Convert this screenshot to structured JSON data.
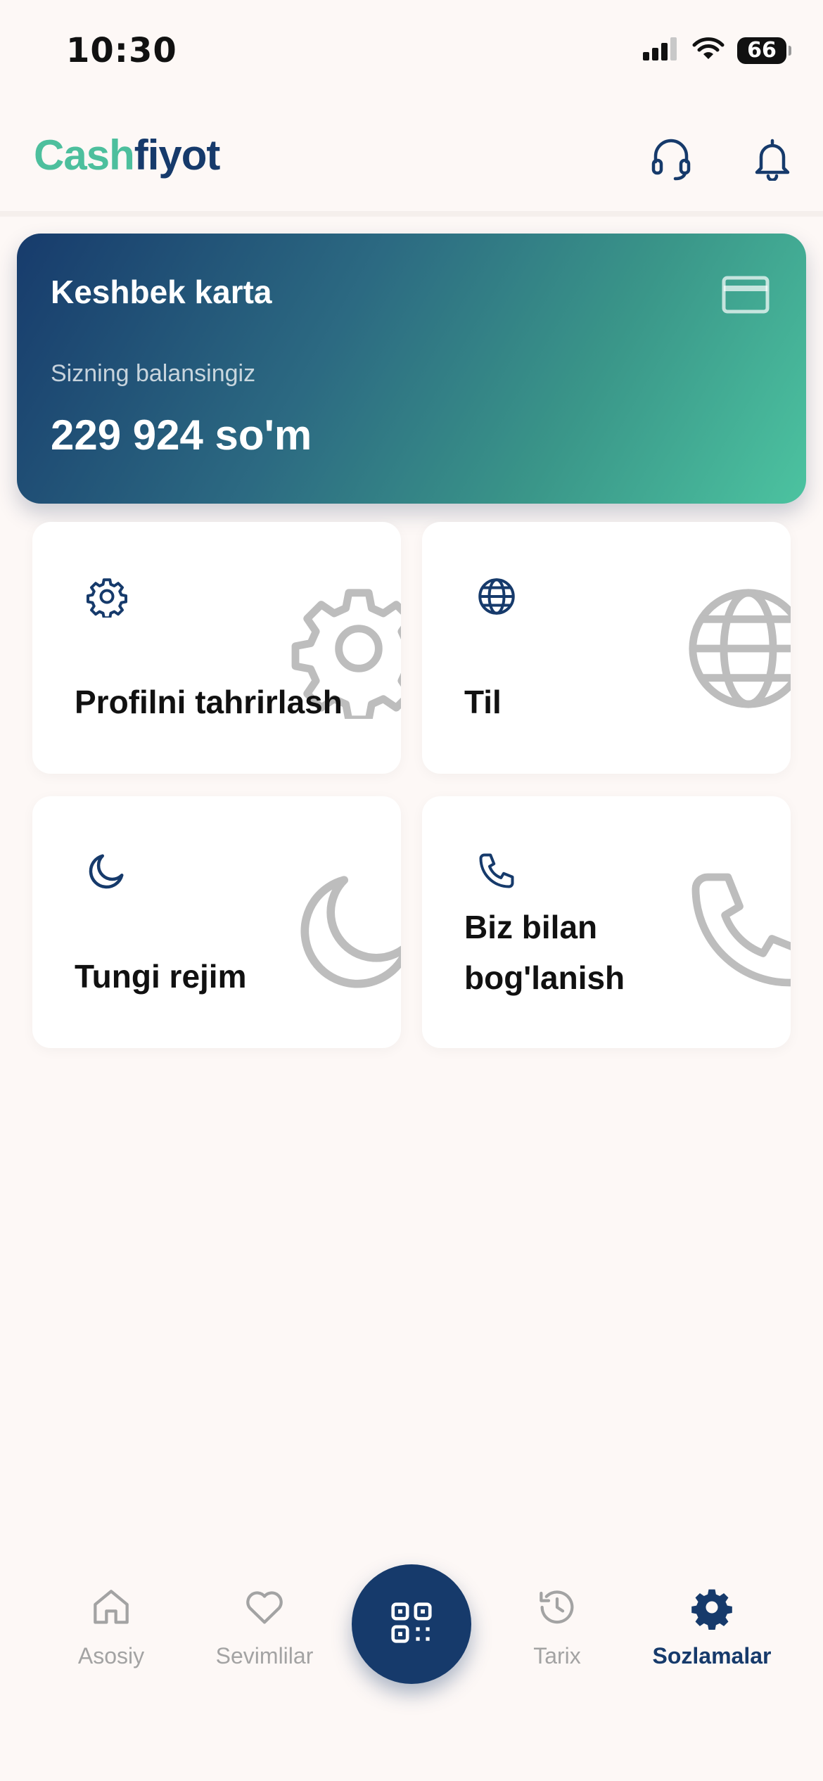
{
  "status_bar": {
    "time": "10:30",
    "battery": "66"
  },
  "header": {
    "logo_part1": "Cash",
    "logo_part2": "fiyot",
    "support_icon": "headset-icon",
    "notifications_icon": "bell-icon"
  },
  "card": {
    "title": "Keshbek karta",
    "subtitle": "Sizning balansingiz",
    "balance": "229 924 so'm",
    "icon": "credit-card-icon"
  },
  "tiles": [
    {
      "label": "Profilni tahrirlash",
      "icon": "gear-icon"
    },
    {
      "label": "Til",
      "icon": "globe-icon"
    },
    {
      "label": "Tungi rejim",
      "icon": "moon-icon"
    },
    {
      "label_line1": "Biz bilan",
      "label_line2": "bog'lanish",
      "icon": "phone-icon"
    }
  ],
  "bottom_nav": {
    "items": [
      {
        "label": "Asosiy",
        "icon": "home-icon"
      },
      {
        "label": "Sevimlilar",
        "icon": "heart-icon"
      },
      {
        "label": "Tarix",
        "icon": "history-icon"
      },
      {
        "label": "Sozlamalar",
        "icon": "gear-icon",
        "active": true
      }
    ],
    "center_icon": "qr-code-icon"
  },
  "colors": {
    "brand_navy": "#163a6b",
    "brand_green": "#4dbf9d",
    "background": "#fdf8f6",
    "inactive_nav": "#a3a3a3"
  }
}
